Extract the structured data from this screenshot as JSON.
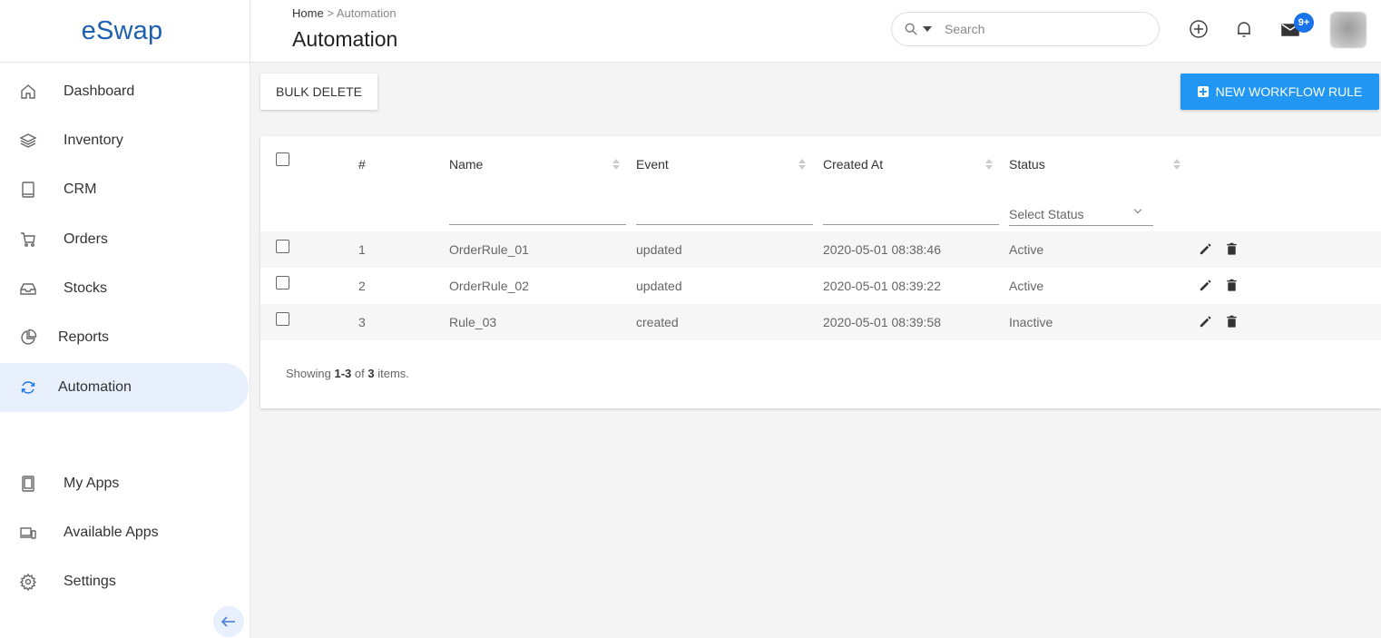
{
  "app": {
    "logo": "eSwap"
  },
  "sidebar": {
    "items": [
      {
        "label": "Dashboard",
        "icon": "home-icon"
      },
      {
        "label": "Inventory",
        "icon": "layers-icon"
      },
      {
        "label": "CRM",
        "icon": "book-icon"
      },
      {
        "label": "Orders",
        "icon": "cart-icon"
      },
      {
        "label": "Stocks",
        "icon": "inbox-icon"
      },
      {
        "label": "Reports",
        "icon": "pie-chart-icon"
      },
      {
        "label": "Automation",
        "icon": "sync-icon",
        "active": true
      }
    ],
    "bottom_items": [
      {
        "label": "My Apps",
        "icon": "tablet-icon"
      },
      {
        "label": "Available Apps",
        "icon": "devices-icon"
      },
      {
        "label": "Settings",
        "icon": "gear-icon"
      }
    ]
  },
  "header": {
    "breadcrumb_home": "Home",
    "breadcrumb_sep": ">",
    "breadcrumb_current": "Automation",
    "title": "Automation",
    "search_placeholder": "Search",
    "notification_badge": "9+"
  },
  "toolbar": {
    "bulk_delete_label": "BULK DELETE",
    "new_rule_label": "NEW WORKFLOW RULE"
  },
  "table": {
    "columns": {
      "num": "#",
      "name": "Name",
      "event": "Event",
      "created_at": "Created At",
      "status": "Status"
    },
    "status_filter_placeholder": "Select Status",
    "rows": [
      {
        "num": "1",
        "name": "OrderRule_01",
        "event": "updated",
        "created_at": "2020-05-01 08:38:46",
        "status": "Active"
      },
      {
        "num": "2",
        "name": "OrderRule_02",
        "event": "updated",
        "created_at": "2020-05-01 08:39:22",
        "status": "Active"
      },
      {
        "num": "3",
        "name": "Rule_03",
        "event": "created",
        "created_at": "2020-05-01 08:39:58",
        "status": "Inactive"
      }
    ],
    "summary": {
      "prefix": "Showing",
      "range": "1-3",
      "of": "of",
      "total": "3",
      "suffix": "items."
    }
  },
  "colors": {
    "brand": "#1e5fb0",
    "accent": "#2196f3",
    "active_bg": "#e8f0fd"
  }
}
